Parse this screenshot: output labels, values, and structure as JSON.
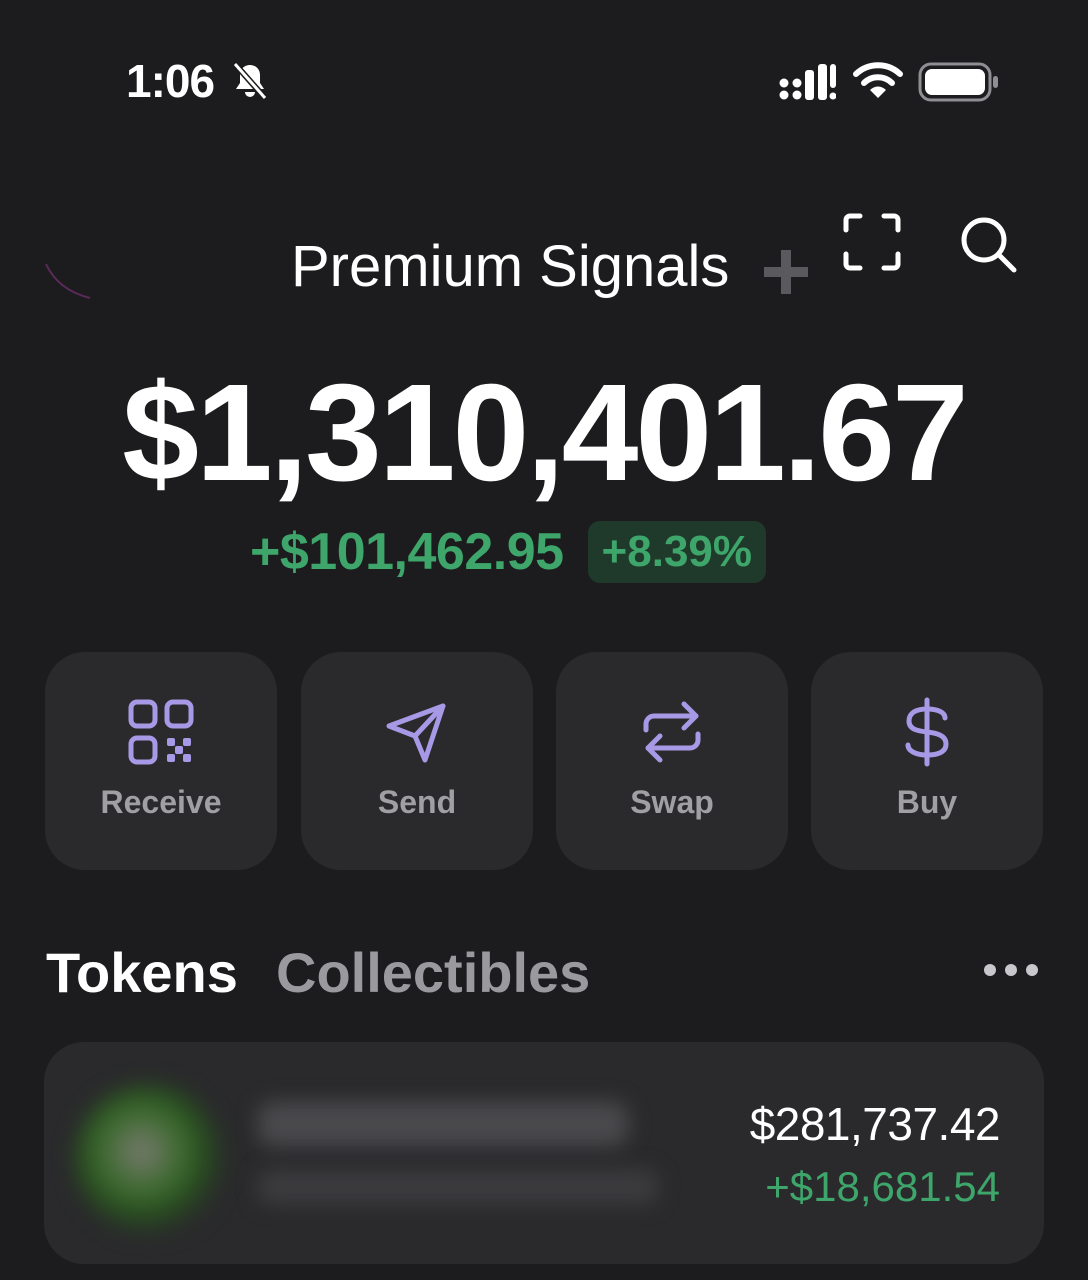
{
  "status_bar": {
    "time": "1:06"
  },
  "header": {
    "title": "Premium Signals"
  },
  "balance": {
    "total": "$1,310,401.67",
    "change_amount": "+$101,462.95",
    "change_percent": "+8.39%"
  },
  "actions": [
    {
      "label": "Receive",
      "icon": "qr-code-icon"
    },
    {
      "label": "Send",
      "icon": "paper-plane-icon"
    },
    {
      "label": "Swap",
      "icon": "swap-arrows-icon"
    },
    {
      "label": "Buy",
      "icon": "dollar-icon"
    }
  ],
  "tabs": {
    "tokens": "Tokens",
    "collectibles": "Collectibles"
  },
  "tokens": [
    {
      "value": "$281,737.42",
      "change": "+$18,681.54"
    }
  ],
  "colors": {
    "background": "#1c1c1e",
    "card": "#2a2a2c",
    "accent_purple": "#a899e6",
    "positive_green": "#3ea66b"
  }
}
